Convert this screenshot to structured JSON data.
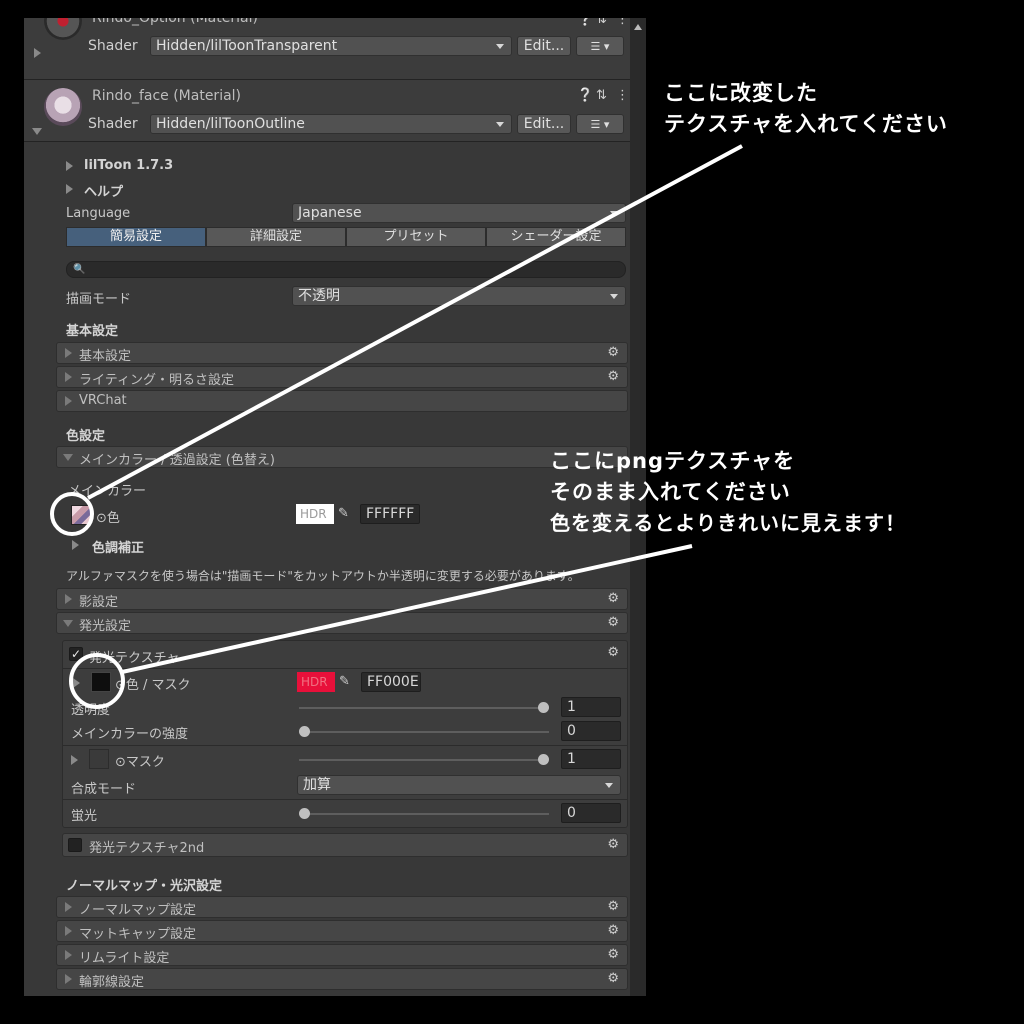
{
  "material1": {
    "name": "Rindo_Option (Material)",
    "shader_label": "Shader",
    "shader_value": "Hidden/lilToonTransparent",
    "edit_label": "Edit..."
  },
  "material2": {
    "name": "Rindo_face (Material)",
    "shader_label": "Shader",
    "shader_value": "Hidden/lilToonOutline",
    "edit_label": "Edit..."
  },
  "liltoon": {
    "version": "lilToon 1.7.3",
    "help": "ヘルプ",
    "language_label": "Language",
    "language_value": "Japanese",
    "tabs": [
      "簡易設定",
      "詳細設定",
      "プリセット",
      "シェーダー設定"
    ],
    "render_mode_label": "描画モード",
    "render_mode_value": "不透明"
  },
  "basic": {
    "heading": "基本設定",
    "sections": [
      "基本設定",
      "ライティング・明るさ設定",
      "VRChat"
    ]
  },
  "color": {
    "heading": "色設定",
    "main_section": "メインカラー / 透過設定 (色替え)",
    "main_label": "メインカラー",
    "color_prop": "色",
    "hdr": "HDR",
    "hex": "FFFFFF",
    "tone": "色調補正",
    "note": "アルファマスクを使う場合は\"描画モード\"をカットアウトか半透明に変更する必要があります。",
    "shadow": "影設定",
    "emission": "発光設定"
  },
  "emission": {
    "texture_label": "発光テクスチャ",
    "color_mask": "色 / マスク",
    "hdr": "HDR",
    "hex": "FF000E",
    "color_hex": "#e8103a",
    "opacity_label": "透明度",
    "opacity_value": "1",
    "opacity_frac": 1,
    "main_strength_label": "メインカラーの強度",
    "main_strength_value": "0",
    "main_strength_frac": 0,
    "mask_label": "マスク",
    "mask_value": "1",
    "mask_frac": 1,
    "blend_label": "合成モード",
    "blend_value": "加算",
    "fluor_label": "蛍光",
    "fluor_value": "0",
    "fluor_frac": 0,
    "second": "発光テクスチャ2nd"
  },
  "normal": {
    "heading": "ノーマルマップ・光沢設定",
    "sections": [
      "ノーマルマップ設定",
      "マットキャップ設定",
      "リムライト設定",
      "輪郭線設定"
    ]
  },
  "annotations": {
    "top": [
      "ここに改変した",
      "テクスチャを入れてください"
    ],
    "bottom": [
      "ここにpngテクスチャを",
      "そのまま入れてください",
      "色を変えるとよりきれいに見えます！"
    ]
  },
  "icons": {
    "gear": "gear-icon",
    "help": "help-icon",
    "settings": "settings-icon",
    "menu": "menu-icon",
    "search": "search-icon",
    "eyedropper": "eyedropper-icon"
  }
}
